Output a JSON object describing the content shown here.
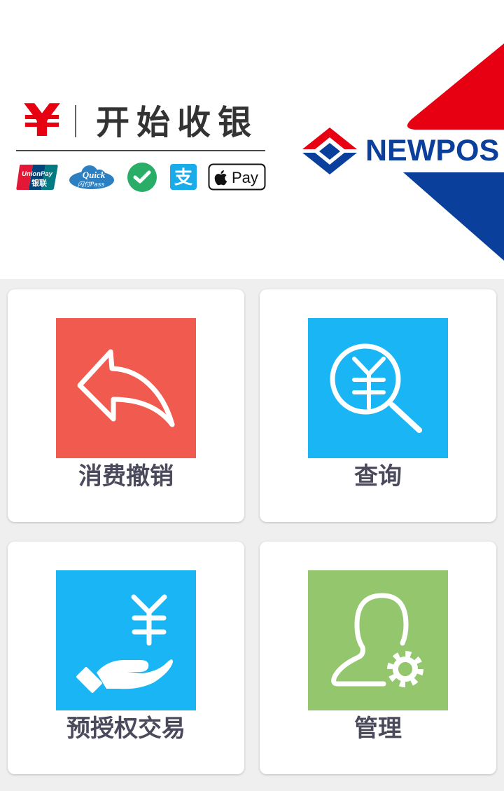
{
  "banner": {
    "yuan_symbol": "¥",
    "title": "开始收银",
    "payment_logos": {
      "unionpay": {
        "text": "UnionPay",
        "text_cn": "银联"
      },
      "quickpass": {
        "text": "Quick",
        "text_cn": "闪付Pass"
      },
      "wechat": {
        "icon": "wechat-pay-icon"
      },
      "alipay": {
        "text": "支"
      },
      "applepay": {
        "text": "Pay"
      }
    },
    "brand": "NEWPOS",
    "colors": {
      "red": "#e60012",
      "blue": "#0b3f9c"
    }
  },
  "menu": {
    "items": [
      {
        "label": "消费撤销",
        "icon": "reply-arrow-icon",
        "color": "#f15b4f"
      },
      {
        "label": "查询",
        "icon": "search-yuan-icon",
        "color": "#1ab5f5"
      },
      {
        "label": "预授权交易",
        "icon": "hand-yuan-icon",
        "color": "#1ab5f5"
      },
      {
        "label": "管理",
        "icon": "user-gear-icon",
        "color": "#93c66d"
      }
    ]
  }
}
